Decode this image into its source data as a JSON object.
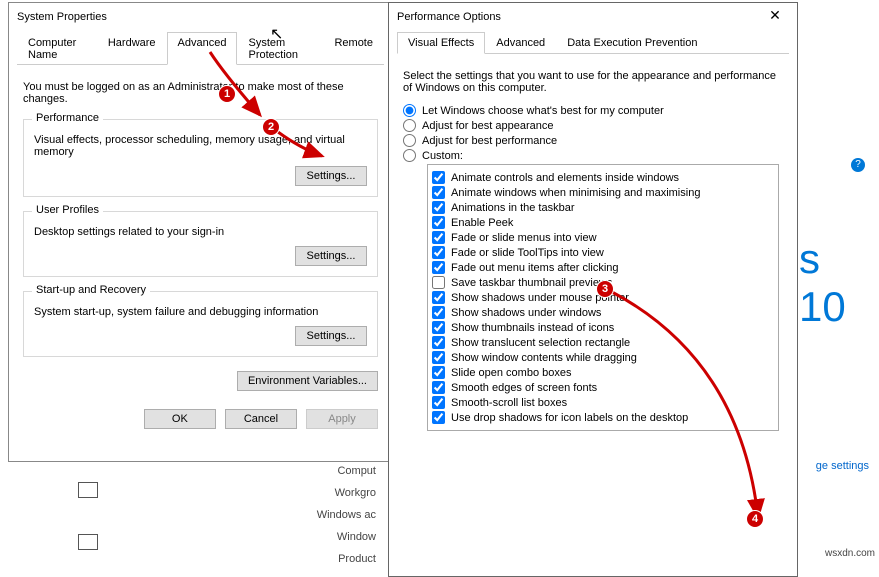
{
  "sp": {
    "title": "System Properties",
    "tabs": [
      "Computer Name",
      "Hardware",
      "Advanced",
      "System Protection",
      "Remote"
    ],
    "activeTab": 2,
    "note": "You must be logged on as an Administrator to make most of these changes.",
    "groups": {
      "perf": {
        "title": "Performance",
        "desc": "Visual effects, processor scheduling, memory usage, and virtual memory",
        "btn": "Settings..."
      },
      "prof": {
        "title": "User Profiles",
        "desc": "Desktop settings related to your sign-in",
        "btn": "Settings..."
      },
      "start": {
        "title": "Start-up and Recovery",
        "desc": "System start-up, system failure and debugging information",
        "btn": "Settings..."
      }
    },
    "envBtn": "Environment Variables...",
    "ok": "OK",
    "cancel": "Cancel",
    "apply": "Apply"
  },
  "po": {
    "title": "Performance Options",
    "tabs": [
      "Visual Effects",
      "Advanced",
      "Data Execution Prevention"
    ],
    "activeTab": 0,
    "intro": "Select the settings that you want to use for the appearance and performance of Windows on this computer.",
    "radios": [
      {
        "label": "Let Windows choose what's best for my computer",
        "sel": true
      },
      {
        "label": "Adjust for best appearance",
        "sel": false
      },
      {
        "label": "Adjust for best performance",
        "sel": false
      },
      {
        "label": "Custom:",
        "sel": false
      }
    ],
    "checks": [
      {
        "label": "Animate controls and elements inside windows",
        "c": true
      },
      {
        "label": "Animate windows when minimising and maximising",
        "c": true
      },
      {
        "label": "Animations in the taskbar",
        "c": true
      },
      {
        "label": "Enable Peek",
        "c": true
      },
      {
        "label": "Fade or slide menus into view",
        "c": true
      },
      {
        "label": "Fade or slide ToolTips into view",
        "c": true
      },
      {
        "label": "Fade out menu items after clicking",
        "c": true
      },
      {
        "label": "Save taskbar thumbnail previews",
        "c": false
      },
      {
        "label": "Show shadows under mouse pointer",
        "c": true
      },
      {
        "label": "Show shadows under windows",
        "c": true
      },
      {
        "label": "Show thumbnails instead of icons",
        "c": true
      },
      {
        "label": "Show translucent selection rectangle",
        "c": true
      },
      {
        "label": "Show window contents while dragging",
        "c": true
      },
      {
        "label": "Slide open combo boxes",
        "c": true
      },
      {
        "label": "Smooth edges of screen fonts",
        "c": true
      },
      {
        "label": "Smooth-scroll list boxes",
        "c": true
      },
      {
        "label": "Use drop shadows for icon labels on the desktop",
        "c": true
      }
    ]
  },
  "bg": {
    "win10": "s 10",
    "changeSettings": "ge settings",
    "labels": [
      "Comput",
      "Workgro",
      "",
      "Windows ac",
      "Window",
      "",
      "Product"
    ],
    "watermark": "wsxdn.com",
    "help": "?"
  }
}
